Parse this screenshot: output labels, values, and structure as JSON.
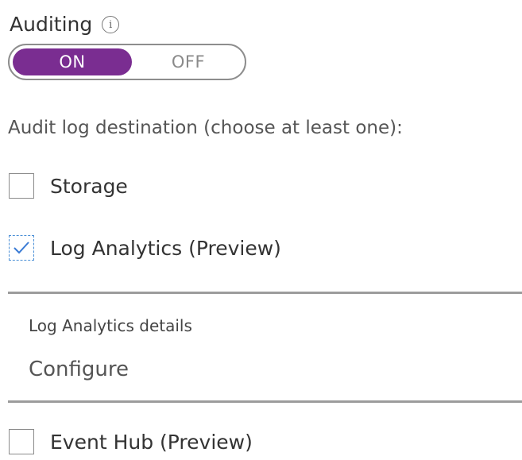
{
  "auditing": {
    "label": "Auditing",
    "info_icon": "info-icon",
    "toggle": {
      "on_label": "ON",
      "off_label": "OFF",
      "selected": "ON",
      "accent_color": "#7a2d91"
    }
  },
  "destination": {
    "label": "Audit log destination (choose at least one):",
    "options": [
      {
        "label": "Storage",
        "checked": false
      },
      {
        "label": "Log Analytics (Preview)",
        "checked": true
      },
      {
        "label": "Event Hub (Preview)",
        "checked": false
      }
    ]
  },
  "log_analytics": {
    "details_label": "Log Analytics details",
    "configure_label": "Configure"
  }
}
